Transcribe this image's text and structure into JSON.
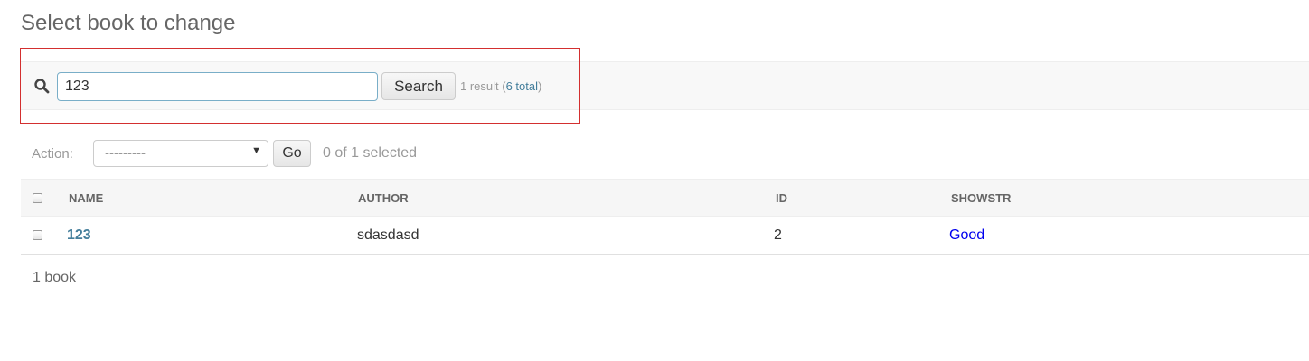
{
  "page": {
    "title": "Select book to change"
  },
  "search": {
    "value": "123",
    "button_label": "Search",
    "result_text": "1 result (",
    "total_link": "6 total",
    "result_close": ")"
  },
  "actions": {
    "label": "Action:",
    "selected_option": "---------",
    "go_label": "Go",
    "selected_count": "0 of 1 selected"
  },
  "table": {
    "columns": [
      "NAME",
      "AUTHOR",
      "ID",
      "SHOWSTR"
    ],
    "rows": [
      {
        "name": "123",
        "author": "sdasdasd",
        "id": "2",
        "showstr": "Good"
      }
    ]
  },
  "paginator": {
    "text": "1 book"
  },
  "colors": {
    "link": "#447e9b",
    "showstr": "#0000ee",
    "highlight_border": "#d32f2f",
    "input_border": "#79aec8"
  }
}
